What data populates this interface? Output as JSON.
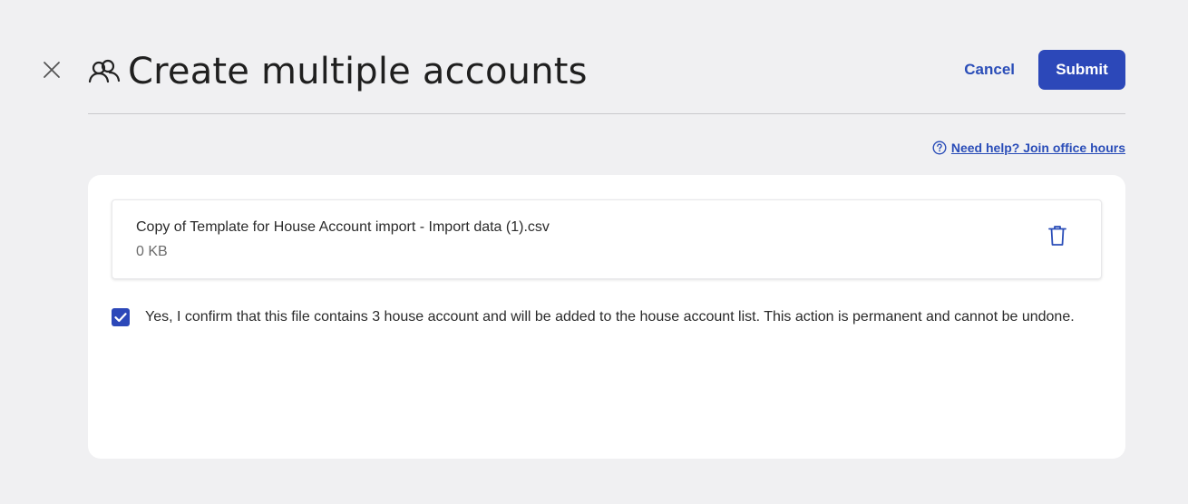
{
  "header": {
    "title": "Create multiple accounts",
    "cancel_label": "Cancel",
    "submit_label": "Submit",
    "title_icon": "users-icon",
    "close_icon": "close-icon"
  },
  "help": {
    "label": "Need help? Join office hours",
    "icon": "question-circle-icon"
  },
  "upload": {
    "file_name": "Copy of Template for House Account import - Import data (1).csv",
    "file_size": "0 KB",
    "delete_icon": "trash-icon"
  },
  "confirmation": {
    "checked": true,
    "text": "Yes, I confirm that this file contains 3 house account and will be added to the house account list. This action is permanent and cannot be undone."
  },
  "colors": {
    "background": "#f0f0f2",
    "accent": "#2c48b9",
    "link": "#2a4db8",
    "card": "#ffffff"
  }
}
